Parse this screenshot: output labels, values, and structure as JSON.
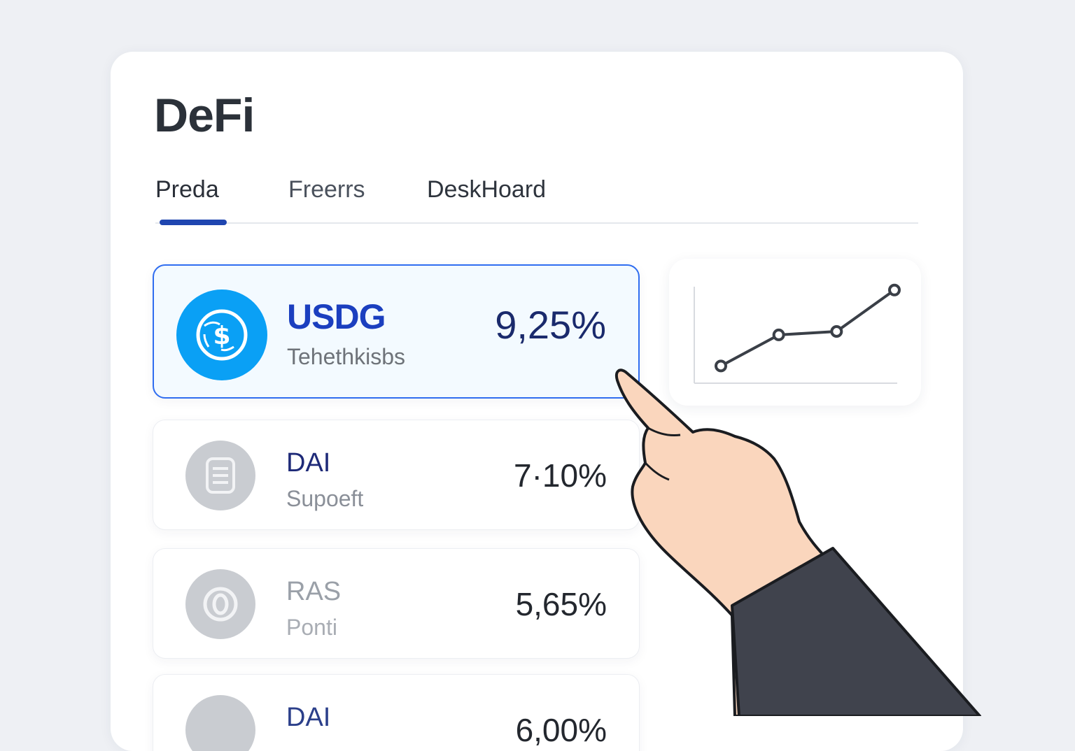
{
  "page": {
    "title": "DeFi"
  },
  "tabs": [
    {
      "label": "Preda",
      "active": true
    },
    {
      "label": "Freerrs",
      "active": false
    },
    {
      "label": "DeskHoard",
      "active": false
    }
  ],
  "assets": [
    {
      "name": "USDG",
      "subtitle": "Tehethkisbs",
      "rate": "9,25%",
      "icon": "dollar-globe-icon",
      "selected": true
    },
    {
      "name": "DAI",
      "subtitle": "Supoeft",
      "rate": "7·10%",
      "icon": "document-icon",
      "selected": false
    },
    {
      "name": "RAS",
      "subtitle": "Ponti",
      "rate": "5,65%",
      "icon": "ring-icon",
      "selected": false
    },
    {
      "name": "DAI",
      "subtitle": "",
      "rate": "6,00%",
      "icon": "coin-icon",
      "selected": false
    }
  ],
  "chart_data": {
    "type": "line",
    "x": [
      1,
      2,
      3,
      4
    ],
    "values": [
      1.0,
      2.8,
      3.0,
      5.4
    ],
    "title": "",
    "xlabel": "",
    "ylabel": "",
    "ylim": [
      0,
      6
    ],
    "grid": false
  },
  "colors": {
    "accent": "#2f6df0",
    "tab_indicator": "#1f46b0",
    "selected_coin": "#0aa0f5",
    "muted_coin": "#c9ccd1"
  }
}
